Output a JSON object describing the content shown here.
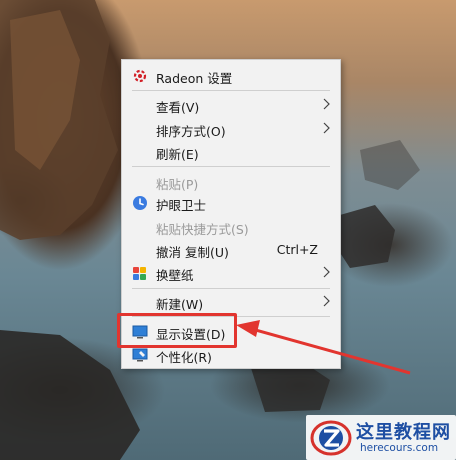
{
  "context_menu": {
    "items": [
      {
        "label": "Radeon 设置",
        "icon": "radeon-icon",
        "enabled": true
      },
      {
        "label": "查看(V)",
        "submenu": true,
        "enabled": true
      },
      {
        "label": "排序方式(O)",
        "submenu": true,
        "enabled": true
      },
      {
        "label": "刷新(E)",
        "enabled": true
      },
      {
        "label": "粘贴(P)",
        "enabled": false
      },
      {
        "label": "护眼卫士",
        "icon": "eye-guard-icon",
        "enabled": true
      },
      {
        "label": "粘贴快捷方式(S)",
        "enabled": false
      },
      {
        "label": "撤消 复制(U)",
        "shortcut": "Ctrl+Z",
        "enabled": true
      },
      {
        "label": "换壁纸",
        "icon": "wallpaper-icon",
        "submenu": true,
        "enabled": true
      },
      {
        "label": "新建(W)",
        "submenu": true,
        "enabled": true
      },
      {
        "label": "显示设置(D)",
        "icon": "display-icon",
        "enabled": true,
        "highlighted": true
      },
      {
        "label": "个性化(R)",
        "icon": "personalize-icon",
        "enabled": true
      }
    ]
  },
  "annotation": {
    "color": "#e2352f"
  },
  "watermark": {
    "title": "这里教程网",
    "subtitle": "herecours.com"
  }
}
